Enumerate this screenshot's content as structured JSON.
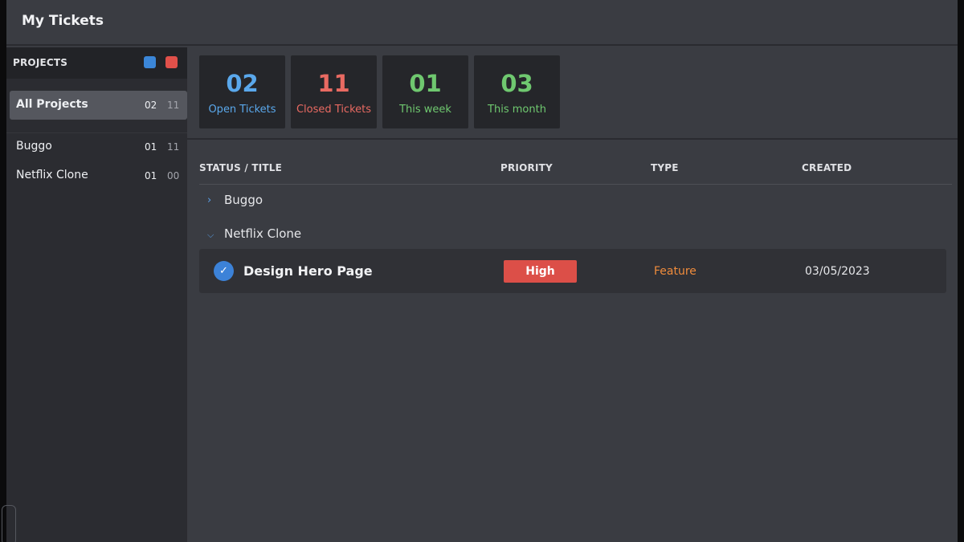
{
  "app": {
    "title": "My Tickets"
  },
  "sidebar": {
    "header_label": "PROJECTS",
    "legend": [
      {
        "name": "open",
        "color": "#3b86d8"
      },
      {
        "name": "closed",
        "color": "#e0504a"
      }
    ],
    "items": [
      {
        "label": "All Projects",
        "open": "02",
        "closed": "11",
        "active": true
      },
      {
        "label": "Buggo",
        "open": "01",
        "closed": "11"
      },
      {
        "label": "Netflix Clone",
        "open": "01",
        "closed": "00"
      }
    ]
  },
  "stats": [
    {
      "value": "02",
      "label": "Open Tickets",
      "color": "#5aa8ec"
    },
    {
      "value": "11",
      "label": "Closed Tickets",
      "color": "#e96a62"
    },
    {
      "value": "01",
      "label": "This week",
      "color": "#6fc86f"
    },
    {
      "value": "03",
      "label": "This month",
      "color": "#6fc86f"
    }
  ],
  "table": {
    "headers": {
      "status_title": "STATUS / TITLE",
      "priority": "PRIORITY",
      "type": "TYPE",
      "created": "CREATED"
    },
    "groups": [
      {
        "label": "Buggo",
        "expanded": false,
        "chevron_icon": "chevron-right-icon"
      },
      {
        "label": "Netflix Clone",
        "expanded": true,
        "chevron_icon": "chevron-down-icon"
      }
    ],
    "tickets": [
      {
        "title": "Design Hero Page",
        "priority": "High",
        "type": "Feature",
        "created": "03/05/2023",
        "status_icon": "check-icon"
      }
    ]
  },
  "colors": {
    "priority_high": "#dc4f48",
    "type_feature": "#f08c3c",
    "accent": "#3c82d8"
  }
}
